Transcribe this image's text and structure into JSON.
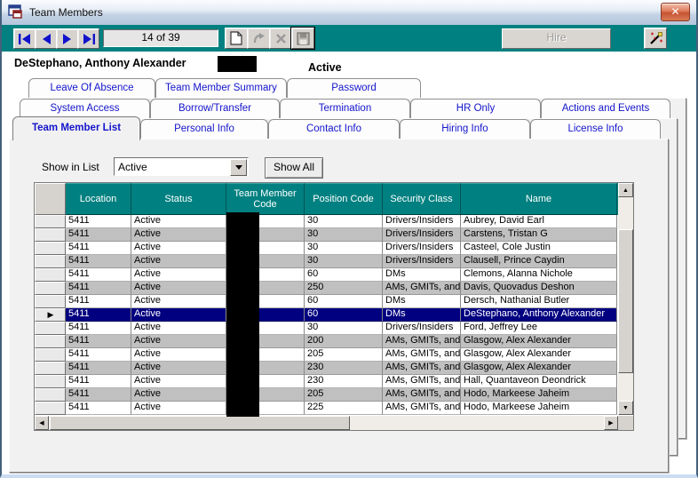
{
  "window": {
    "title": "Team Members",
    "close_label": "✕"
  },
  "toolbar": {
    "record_counter": "14 of 39",
    "hire_label": "Hire",
    "nav": {
      "first": "first record",
      "prev": "previous record",
      "next": "next record",
      "last": "last record"
    },
    "icons": {
      "new": "new-record",
      "undo": "undo",
      "delete": "delete-record",
      "save": "save-record",
      "wand": "wizard"
    }
  },
  "record_header": {
    "name": "DeStephano, Anthony Alexander",
    "status": "Active",
    "code_redacted": true
  },
  "tabs": {
    "row1": [
      "Leave Of Absence",
      "Team Member Summary",
      "Password"
    ],
    "row2": [
      "System Access",
      "Borrow/Transfer",
      "Termination",
      "HR Only",
      "Actions and Events"
    ],
    "row3": [
      "Team Member List",
      "Personal Info",
      "Contact Info",
      "Hiring Info",
      "License Info"
    ],
    "active_tab": "Team Member List"
  },
  "filter": {
    "label": "Show in List",
    "selected_value": "Active",
    "show_all_label": "Show All"
  },
  "grid": {
    "columns": [
      "Location",
      "Status",
      "Team Member Code",
      "Position Code",
      "Security Class",
      "Name"
    ],
    "redacted_columns": [
      "Team Member Code"
    ],
    "selected_index": 7,
    "rows": [
      [
        "5411",
        "Active",
        "",
        "30",
        "Drivers/Insiders",
        "Aubrey, David Earl"
      ],
      [
        "5411",
        "Active",
        "",
        "30",
        "Drivers/Insiders",
        "Carstens, Tristan G"
      ],
      [
        "5411",
        "Active",
        "",
        "30",
        "Drivers/Insiders",
        "Casteel, Cole Justin"
      ],
      [
        "5411",
        "Active",
        "",
        "30",
        "Drivers/Insiders",
        "Clausell, Prince Caydin"
      ],
      [
        "5411",
        "Active",
        "",
        "60",
        "DMs",
        "Clemons, Alanna Nichole"
      ],
      [
        "5411",
        "Active",
        "",
        "250",
        "AMs, GMITs, and S",
        "Davis, Quovadus Deshon"
      ],
      [
        "5411",
        "Active",
        "",
        "60",
        "DMs",
        "Dersch, Nathanial Butler"
      ],
      [
        "5411",
        "Active",
        "",
        "60",
        "DMs",
        "DeStephano, Anthony Alexander"
      ],
      [
        "5411",
        "Active",
        "",
        "30",
        "Drivers/Insiders",
        "Ford, Jeffrey Lee"
      ],
      [
        "5411",
        "Active",
        "",
        "200",
        "AMs, GMITs, and S",
        "Glasgow, Alex Alexander"
      ],
      [
        "5411",
        "Active",
        "",
        "205",
        "AMs, GMITs, and S",
        "Glasgow, Alex Alexander"
      ],
      [
        "5411",
        "Active",
        "",
        "230",
        "AMs, GMITs, and S",
        "Glasgow, Alex Alexander"
      ],
      [
        "5411",
        "Active",
        "",
        "230",
        "AMs, GMITs, and S",
        "Hall, Quantaveon Deondrick"
      ],
      [
        "5411",
        "Active",
        "",
        "205",
        "AMs, GMITs, and S",
        "Hodo, Markeese Jaheim"
      ],
      [
        "5411",
        "Active",
        "",
        "225",
        "AMs, GMITs, and S",
        "Hodo, Markeese Jaheim"
      ]
    ]
  },
  "colors": {
    "teal": "#008080",
    "selection": "#000080",
    "row_alt": "#c0c0c0",
    "tab_text": "#1414cc",
    "redaction": "#000000"
  }
}
